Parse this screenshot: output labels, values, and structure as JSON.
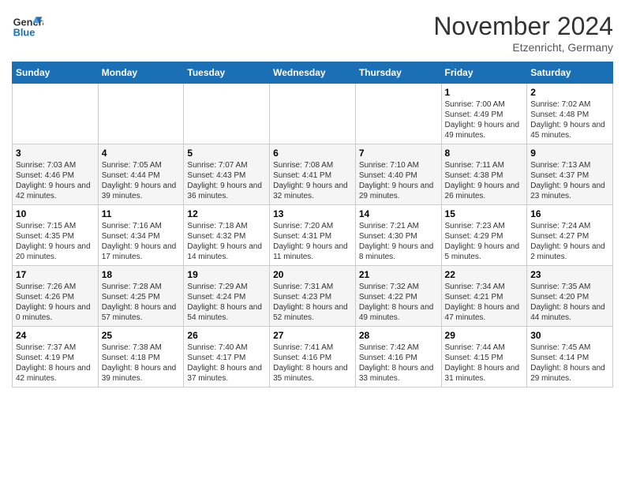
{
  "header": {
    "logo": {
      "line1": "General",
      "line2": "Blue"
    },
    "title": "November 2024",
    "location": "Etzenricht, Germany"
  },
  "calendar": {
    "weekdays": [
      "Sunday",
      "Monday",
      "Tuesday",
      "Wednesday",
      "Thursday",
      "Friday",
      "Saturday"
    ],
    "weeks": [
      [
        {
          "day": "",
          "info": ""
        },
        {
          "day": "",
          "info": ""
        },
        {
          "day": "",
          "info": ""
        },
        {
          "day": "",
          "info": ""
        },
        {
          "day": "",
          "info": ""
        },
        {
          "day": "1",
          "info": "Sunrise: 7:00 AM\nSunset: 4:49 PM\nDaylight: 9 hours and 49 minutes."
        },
        {
          "day": "2",
          "info": "Sunrise: 7:02 AM\nSunset: 4:48 PM\nDaylight: 9 hours and 45 minutes."
        }
      ],
      [
        {
          "day": "3",
          "info": "Sunrise: 7:03 AM\nSunset: 4:46 PM\nDaylight: 9 hours and 42 minutes."
        },
        {
          "day": "4",
          "info": "Sunrise: 7:05 AM\nSunset: 4:44 PM\nDaylight: 9 hours and 39 minutes."
        },
        {
          "day": "5",
          "info": "Sunrise: 7:07 AM\nSunset: 4:43 PM\nDaylight: 9 hours and 36 minutes."
        },
        {
          "day": "6",
          "info": "Sunrise: 7:08 AM\nSunset: 4:41 PM\nDaylight: 9 hours and 32 minutes."
        },
        {
          "day": "7",
          "info": "Sunrise: 7:10 AM\nSunset: 4:40 PM\nDaylight: 9 hours and 29 minutes."
        },
        {
          "day": "8",
          "info": "Sunrise: 7:11 AM\nSunset: 4:38 PM\nDaylight: 9 hours and 26 minutes."
        },
        {
          "day": "9",
          "info": "Sunrise: 7:13 AM\nSunset: 4:37 PM\nDaylight: 9 hours and 23 minutes."
        }
      ],
      [
        {
          "day": "10",
          "info": "Sunrise: 7:15 AM\nSunset: 4:35 PM\nDaylight: 9 hours and 20 minutes."
        },
        {
          "day": "11",
          "info": "Sunrise: 7:16 AM\nSunset: 4:34 PM\nDaylight: 9 hours and 17 minutes."
        },
        {
          "day": "12",
          "info": "Sunrise: 7:18 AM\nSunset: 4:32 PM\nDaylight: 9 hours and 14 minutes."
        },
        {
          "day": "13",
          "info": "Sunrise: 7:20 AM\nSunset: 4:31 PM\nDaylight: 9 hours and 11 minutes."
        },
        {
          "day": "14",
          "info": "Sunrise: 7:21 AM\nSunset: 4:30 PM\nDaylight: 9 hours and 8 minutes."
        },
        {
          "day": "15",
          "info": "Sunrise: 7:23 AM\nSunset: 4:29 PM\nDaylight: 9 hours and 5 minutes."
        },
        {
          "day": "16",
          "info": "Sunrise: 7:24 AM\nSunset: 4:27 PM\nDaylight: 9 hours and 2 minutes."
        }
      ],
      [
        {
          "day": "17",
          "info": "Sunrise: 7:26 AM\nSunset: 4:26 PM\nDaylight: 9 hours and 0 minutes."
        },
        {
          "day": "18",
          "info": "Sunrise: 7:28 AM\nSunset: 4:25 PM\nDaylight: 8 hours and 57 minutes."
        },
        {
          "day": "19",
          "info": "Sunrise: 7:29 AM\nSunset: 4:24 PM\nDaylight: 8 hours and 54 minutes."
        },
        {
          "day": "20",
          "info": "Sunrise: 7:31 AM\nSunset: 4:23 PM\nDaylight: 8 hours and 52 minutes."
        },
        {
          "day": "21",
          "info": "Sunrise: 7:32 AM\nSunset: 4:22 PM\nDaylight: 8 hours and 49 minutes."
        },
        {
          "day": "22",
          "info": "Sunrise: 7:34 AM\nSunset: 4:21 PM\nDaylight: 8 hours and 47 minutes."
        },
        {
          "day": "23",
          "info": "Sunrise: 7:35 AM\nSunset: 4:20 PM\nDaylight: 8 hours and 44 minutes."
        }
      ],
      [
        {
          "day": "24",
          "info": "Sunrise: 7:37 AM\nSunset: 4:19 PM\nDaylight: 8 hours and 42 minutes."
        },
        {
          "day": "25",
          "info": "Sunrise: 7:38 AM\nSunset: 4:18 PM\nDaylight: 8 hours and 39 minutes."
        },
        {
          "day": "26",
          "info": "Sunrise: 7:40 AM\nSunset: 4:17 PM\nDaylight: 8 hours and 37 minutes."
        },
        {
          "day": "27",
          "info": "Sunrise: 7:41 AM\nSunset: 4:16 PM\nDaylight: 8 hours and 35 minutes."
        },
        {
          "day": "28",
          "info": "Sunrise: 7:42 AM\nSunset: 4:16 PM\nDaylight: 8 hours and 33 minutes."
        },
        {
          "day": "29",
          "info": "Sunrise: 7:44 AM\nSunset: 4:15 PM\nDaylight: 8 hours and 31 minutes."
        },
        {
          "day": "30",
          "info": "Sunrise: 7:45 AM\nSunset: 4:14 PM\nDaylight: 8 hours and 29 minutes."
        }
      ]
    ]
  }
}
